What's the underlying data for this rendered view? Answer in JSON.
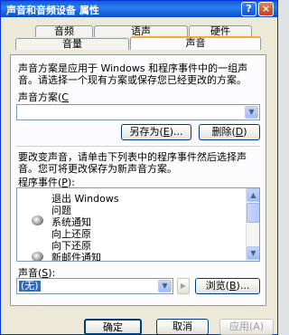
{
  "window": {
    "title": "声音和音频设备 属性",
    "help_glyph": "?",
    "close_glyph": "×"
  },
  "tabs": [
    {
      "label": "音频"
    },
    {
      "label": "语声"
    },
    {
      "label": "硬件"
    },
    {
      "label": "音量"
    },
    {
      "label": "声音",
      "active": true
    }
  ],
  "sounds_tab": {
    "description": "声音方案是应用于 Windows 和程序事件中的一组声音。请选择一个现有方案或保存您已经更改的方案。",
    "scheme_label": "声音方案(",
    "scheme_key": "C",
    "scheme_label_end": "):",
    "scheme_value": "",
    "save_as_label": "另存为(",
    "save_as_key": "E",
    "save_as_end": ")...",
    "delete_label": "删除(",
    "delete_key": "D",
    "delete_end": ")",
    "change_text": "要改变声音，请单击下列表中的程序事件然后选择声音。您可将更改保存为新声音方案。",
    "events_label": "程序事件(",
    "events_key": "P",
    "events_end": "):",
    "events": [
      {
        "label": "退出 Windows",
        "icon": false
      },
      {
        "label": "问题",
        "icon": false
      },
      {
        "label": "系统通知",
        "icon": true
      },
      {
        "label": "向上还原",
        "icon": false
      },
      {
        "label": "向下还原",
        "icon": false
      },
      {
        "label": "新邮件通知",
        "icon": true
      }
    ],
    "sound_label": "声音(",
    "sound_key": "S",
    "sound_end": "):",
    "sound_value": "(无)",
    "browse_label": "浏览(",
    "browse_key": "B",
    "browse_end": ")..."
  },
  "buttons": {
    "ok": "确定",
    "cancel": "取消",
    "apply": "应用(A)"
  },
  "colors": {
    "titlebar": "#0a5fd8",
    "selection": "#316ac5",
    "tab_highlight": "#f8a838"
  }
}
